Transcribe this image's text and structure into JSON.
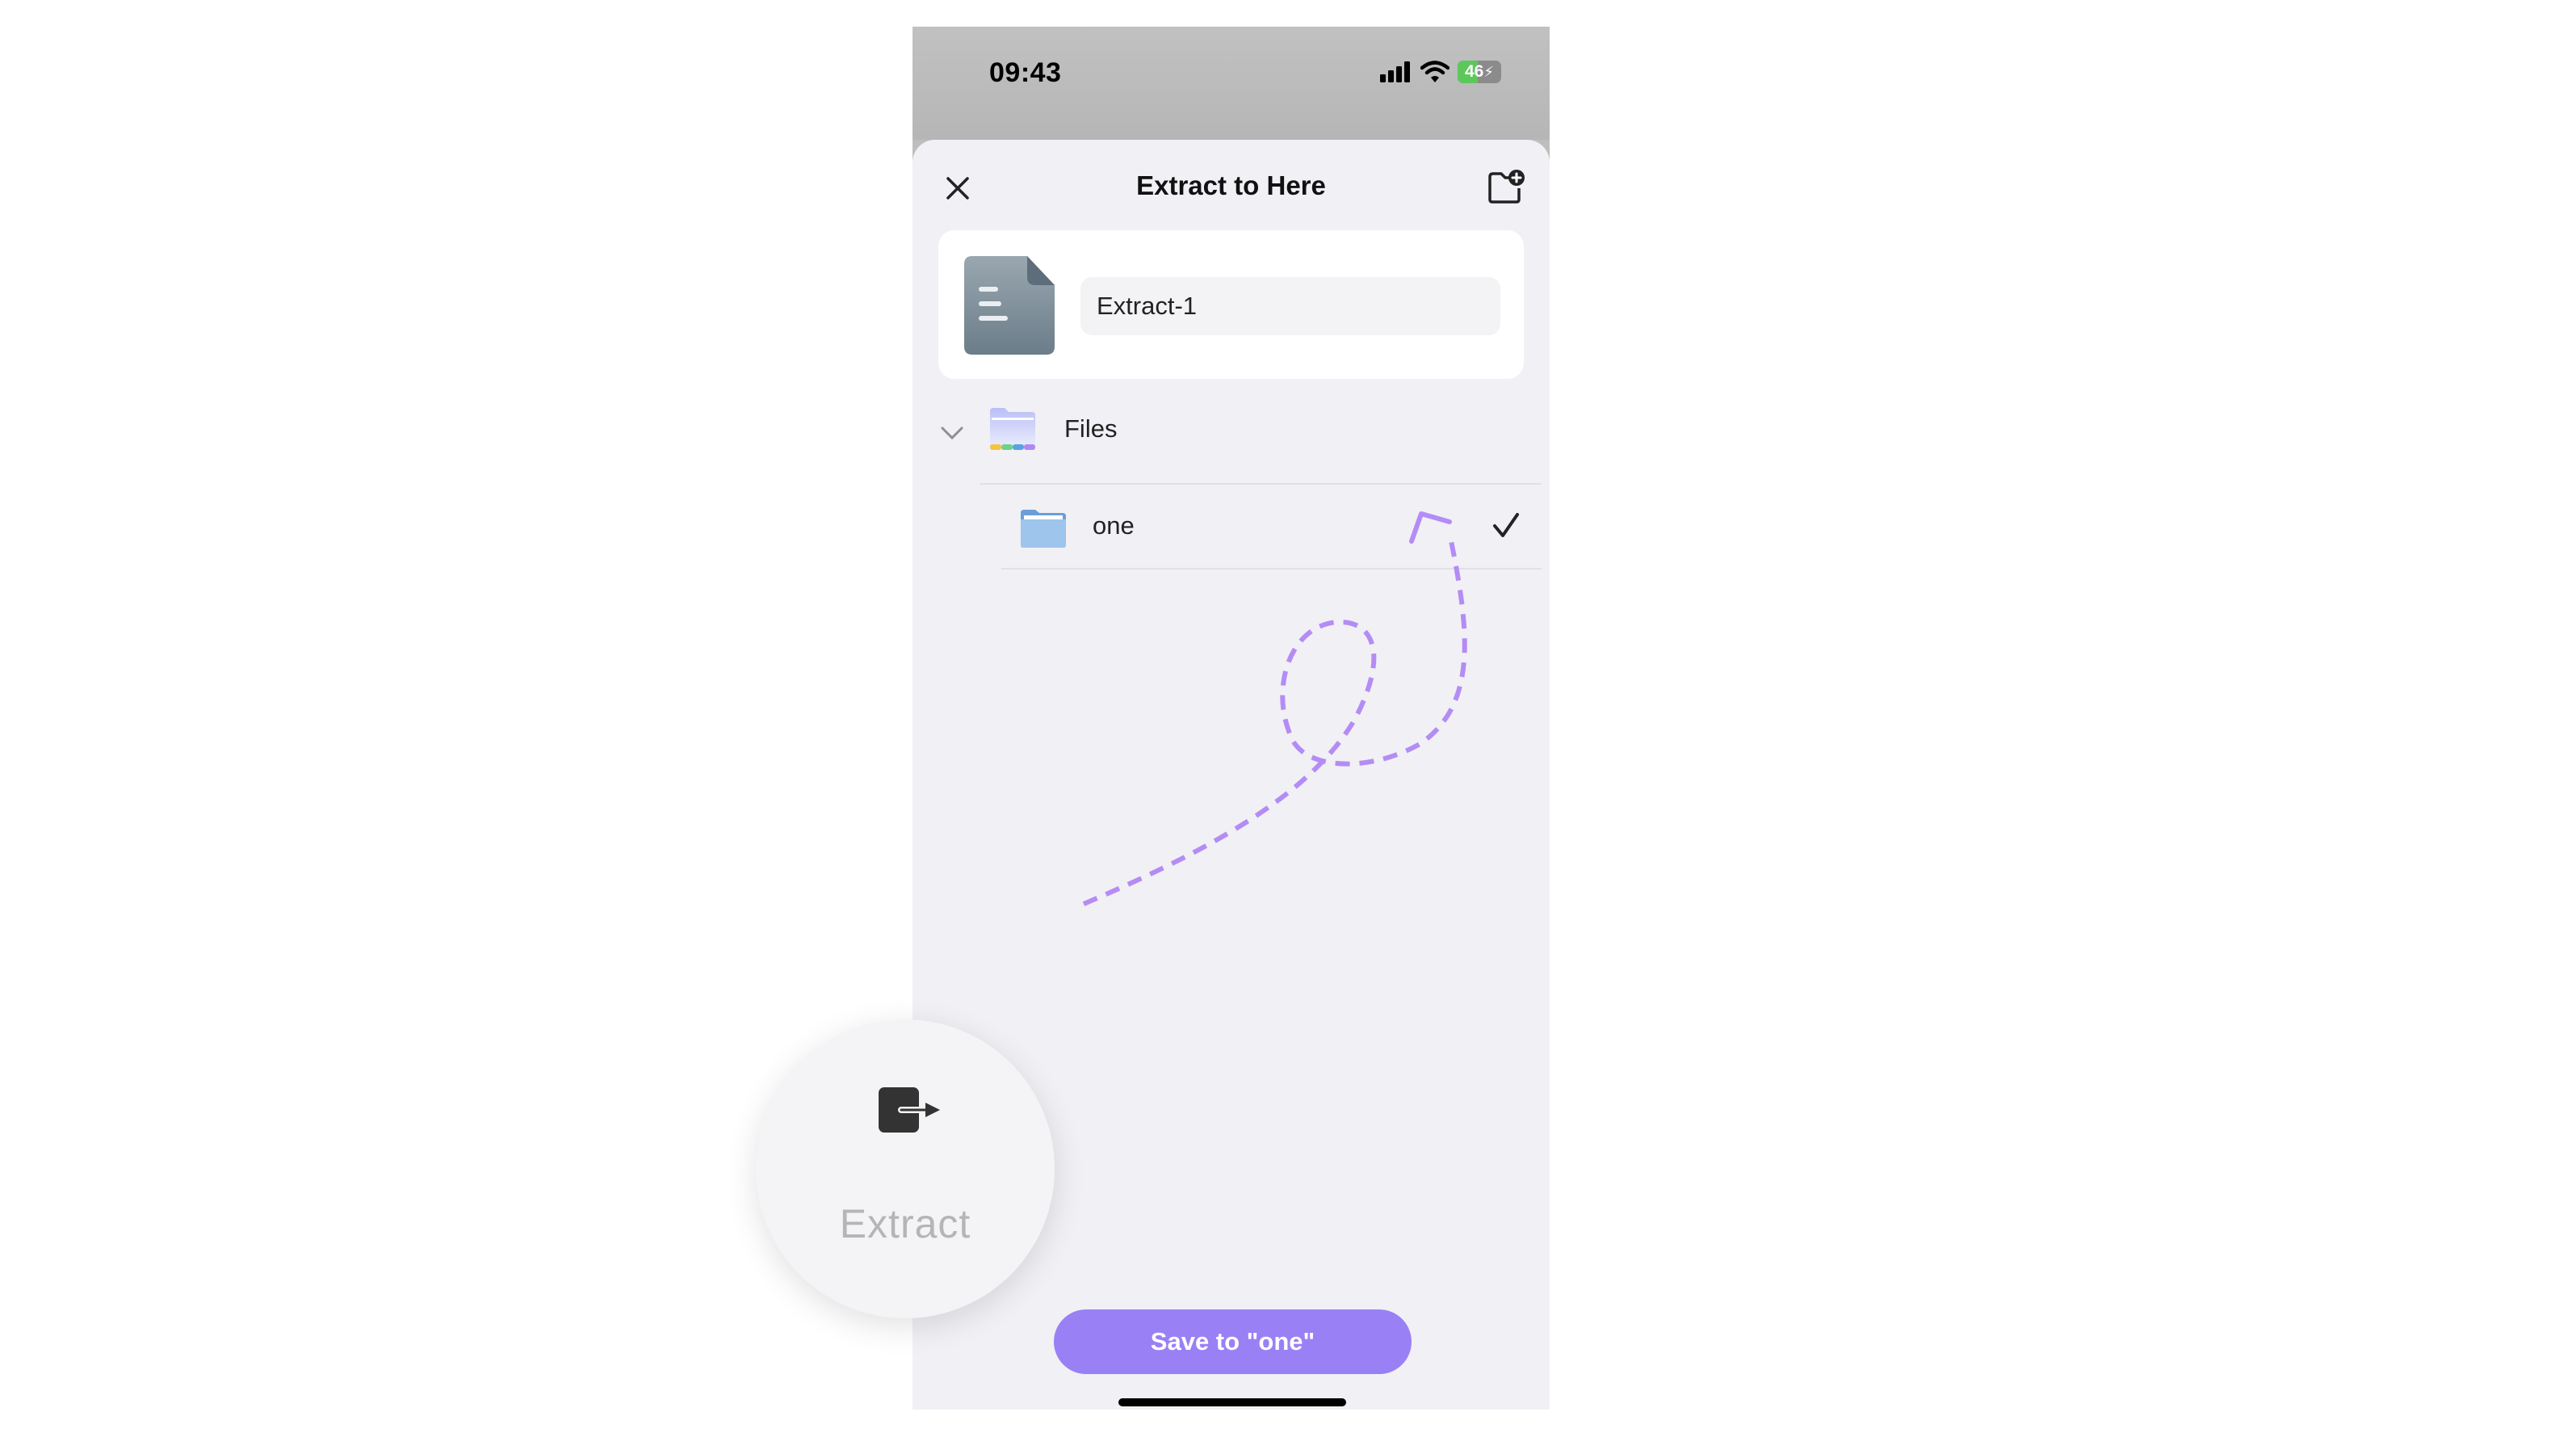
{
  "status_bar": {
    "time": "09:43",
    "battery_level": "46",
    "icons": [
      "signal-icon",
      "wifi-icon",
      "battery-charging-icon"
    ]
  },
  "sheet": {
    "title": "Extract to Here",
    "close_icon": "close-icon",
    "new_folder_icon": "new-folder-icon"
  },
  "name_card": {
    "file_icon": "document-icon",
    "name_value": "Extract-1"
  },
  "tree": {
    "root": {
      "label": "Files",
      "expanded": true,
      "icon": "files-folder-icon"
    },
    "children": [
      {
        "label": "one",
        "selected": true,
        "icon": "folder-icon"
      }
    ]
  },
  "save_button": {
    "label": "Save to \"one\""
  },
  "callout": {
    "label": "Extract",
    "icon": "extract-icon"
  },
  "colors": {
    "accent": "#9a80f5",
    "arrow": "#b48cf5",
    "sheet_bg": "#f1f0f5"
  }
}
